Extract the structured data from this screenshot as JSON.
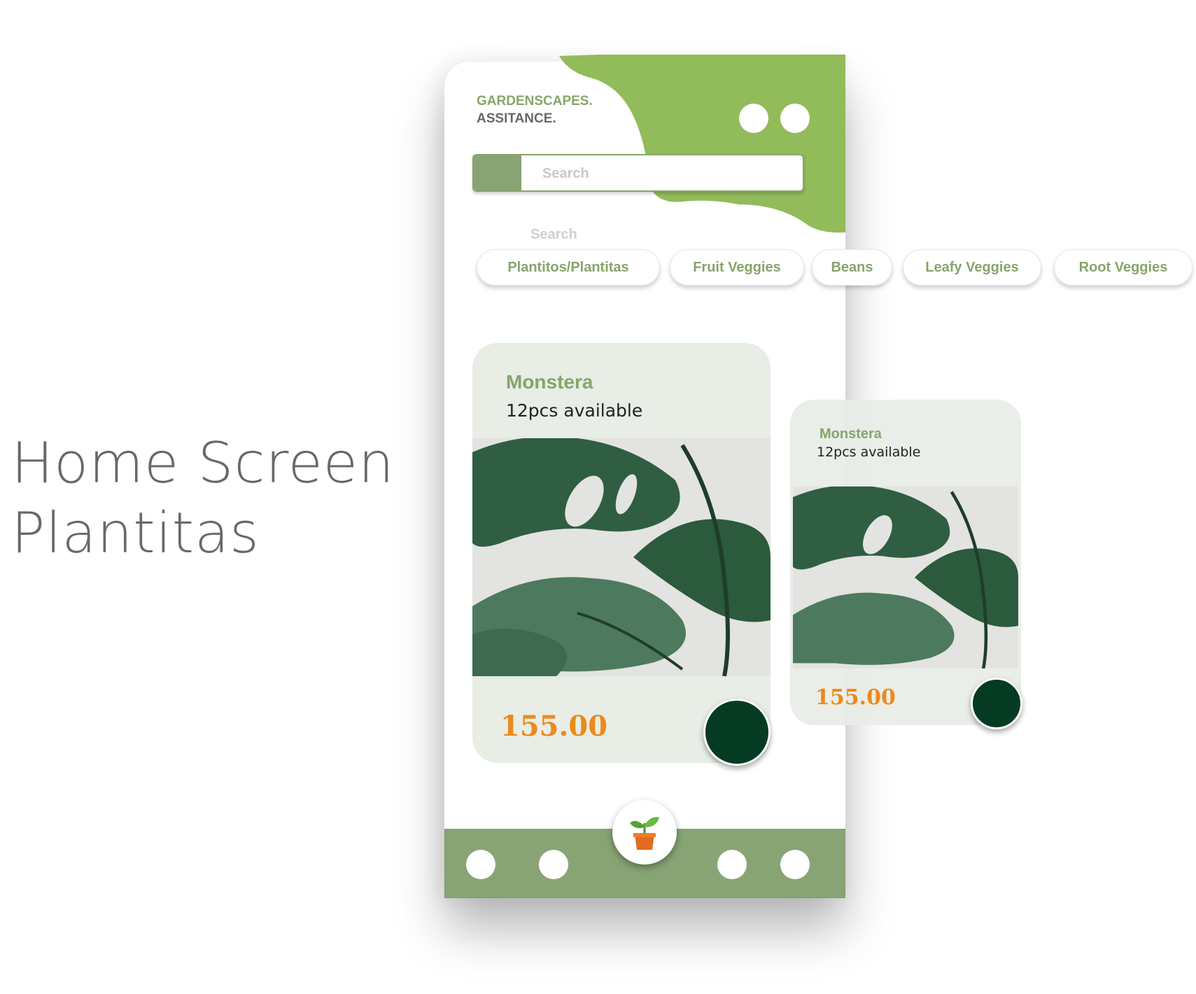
{
  "caption": {
    "line1": "Home Screen",
    "line2": "Plantitas"
  },
  "header": {
    "brand_line1": "GARDENSCAPES.",
    "brand_line2": "ASSITANCE."
  },
  "search": {
    "placeholder": "Search",
    "label": "Search"
  },
  "categories": [
    "Plantitos/Plantitas",
    "Fruit Veggies",
    "Beans",
    "Leafy Veggies",
    "Root Veggies"
  ],
  "product_card": {
    "name": "Monstera",
    "availability": "12pcs available",
    "price": "155.00"
  },
  "product_card_preview": {
    "name": "Monstera",
    "availability": "12pcs available",
    "price": "155.00"
  },
  "bottom_nav": {
    "center_icon": "plant-pot-icon"
  },
  "colors": {
    "accent_green": "#92bb5a",
    "muted_green": "#88a474",
    "brand_green_text": "#86a56b",
    "card_bg": "#e8ede6",
    "price_orange": "#ec8a1c",
    "buy_button": "#053b22"
  }
}
